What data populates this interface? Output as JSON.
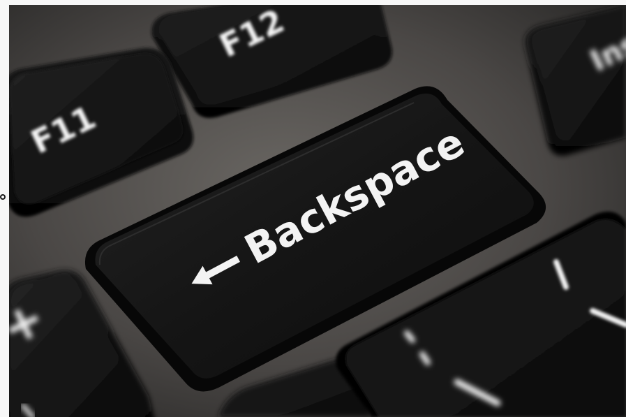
{
  "photo": {
    "subject": "keyboard-closeup",
    "keys": {
      "f11": "F11",
      "f12": "F12",
      "backspace": "Backspace",
      "partial_right": "Ins",
      "plus": "+",
      "backslash": "\\"
    },
    "colors": {
      "key_top": "#141414",
      "key_edge": "#2b2b2b",
      "chassis": "#4b4846",
      "legend": "#f3f3f3"
    }
  }
}
